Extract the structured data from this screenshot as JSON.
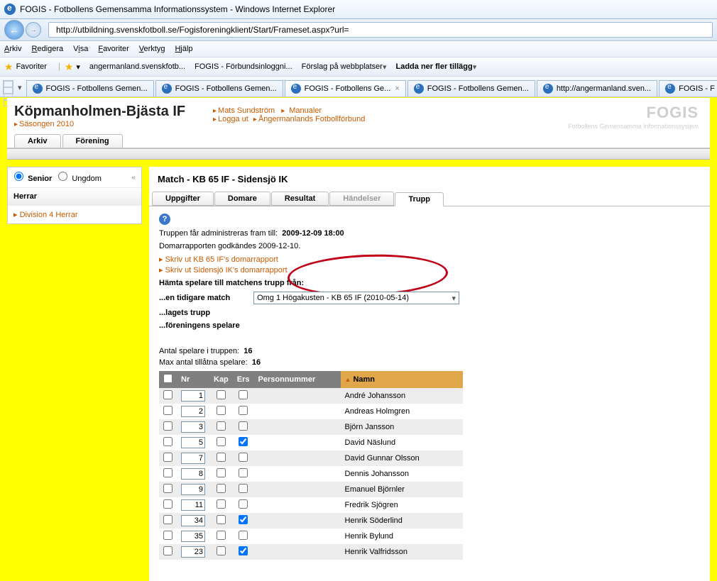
{
  "window_title": "FOGIS - Fotbollens Gemensamma Informationssystem - Windows Internet Explorer",
  "address_url": "http://utbildning.svenskfotboll.se/Fogisforeningklient/Start/Frameset.aspx?url=",
  "menubar": [
    "Arkiv",
    "Redigera",
    "Visa",
    "Favoriter",
    "Verktyg",
    "Hjälp"
  ],
  "menubar_keys": [
    "A",
    "R",
    "V",
    "F",
    "V",
    "H"
  ],
  "favoriter_label": "Favoriter",
  "fav_items": [
    {
      "label": "angermanland.svenskfotb..."
    },
    {
      "label": "FOGIS - Förbundsinloggni..."
    },
    {
      "label": "Förslag på webbplatser",
      "drop": true
    },
    {
      "label": "Ladda ner fler tillägg",
      "drop": true
    }
  ],
  "browser_tabs": [
    {
      "label": "FOGIS - Fotbollens Gemen...",
      "active": false
    },
    {
      "label": "FOGIS - Fotbollens Gemen...",
      "active": false
    },
    {
      "label": "FOGIS - Fotbollens Ge...",
      "active": true,
      "closeable": true
    },
    {
      "label": "FOGIS - Fotbollens Gemen...",
      "active": false
    },
    {
      "label": "http://angermanland.sven...",
      "active": false
    },
    {
      "label": "FOGIS - F",
      "active": false
    }
  ],
  "club": "Köpmanholmen-Bjästa IF",
  "season": "Säsongen 2010",
  "header_links": {
    "user": "Mats Sundström",
    "manual": "Manualer",
    "logout": "Logga ut",
    "fed": "Ångermanlands Fotbollförbund"
  },
  "brand_title": "FOGIS",
  "brand_sub": "Fotbollens Gemensamma Informationssystem",
  "tabsA": [
    "Arkiv",
    "Förening"
  ],
  "sidebar": {
    "senior": "Senior",
    "ungdom": "Ungdom",
    "gender": "Herrar",
    "division": "Division 4 Herrar"
  },
  "content": {
    "title": "Match - KB 65 IF - Sidensjö IK",
    "tabs": [
      "Uppgifter",
      "Domare",
      "Resultat",
      "Händelser",
      "Trupp"
    ],
    "tabs_active": 4,
    "admin_till_label": "Truppen får administreras fram till:",
    "admin_till_value": "2009-12-09 18:00",
    "approved": "Domarrapporten godkändes 2009-12-10.",
    "print1": "Skriv ut KB 65 IF's domarrapport",
    "print2": "Skriv ut Sidensjö IK's domarrapport",
    "fetch_label": "Hämta spelare till matchens trupp från:",
    "opt1": "...en tidigare match",
    "opt1_value": "Omg 1 Högakusten - KB 65 IF (2010-05-14)",
    "opt2": "...lagets trupp",
    "opt3": "...föreningens spelare",
    "count_label": "Antal spelare i truppen:",
    "count_value": "16",
    "max_label": "Max antal tillåtna spelare:",
    "max_value": "16",
    "headers": {
      "nr": "Nr",
      "kap": "Kap",
      "ers": "Ers",
      "pn": "Personnummer",
      "namn": "Namn"
    },
    "players": [
      {
        "nr": "1",
        "ers": false,
        "name": "André Johansson",
        "alt": true
      },
      {
        "nr": "2",
        "ers": false,
        "name": "Andreas Holmgren",
        "alt": false
      },
      {
        "nr": "3",
        "ers": false,
        "name": "Björn Jansson",
        "alt": true
      },
      {
        "nr": "5",
        "ers": true,
        "name": "David Näslund",
        "alt": false
      },
      {
        "nr": "7",
        "ers": false,
        "name": "David Gunnar Olsson",
        "alt": true
      },
      {
        "nr": "8",
        "ers": false,
        "name": "Dennis Johansson",
        "alt": false
      },
      {
        "nr": "9",
        "ers": false,
        "name": "Emanuel Björnler",
        "alt": true
      },
      {
        "nr": "11",
        "ers": false,
        "name": "Fredrik Sjögren",
        "alt": false
      },
      {
        "nr": "34",
        "ers": true,
        "name": "Henrik Söderlind",
        "alt": true
      },
      {
        "nr": "35",
        "ers": false,
        "name": "Henrik Bylund",
        "alt": false
      },
      {
        "nr": "23",
        "ers": true,
        "name": "Henrik Valfridsson",
        "alt": true
      }
    ]
  }
}
